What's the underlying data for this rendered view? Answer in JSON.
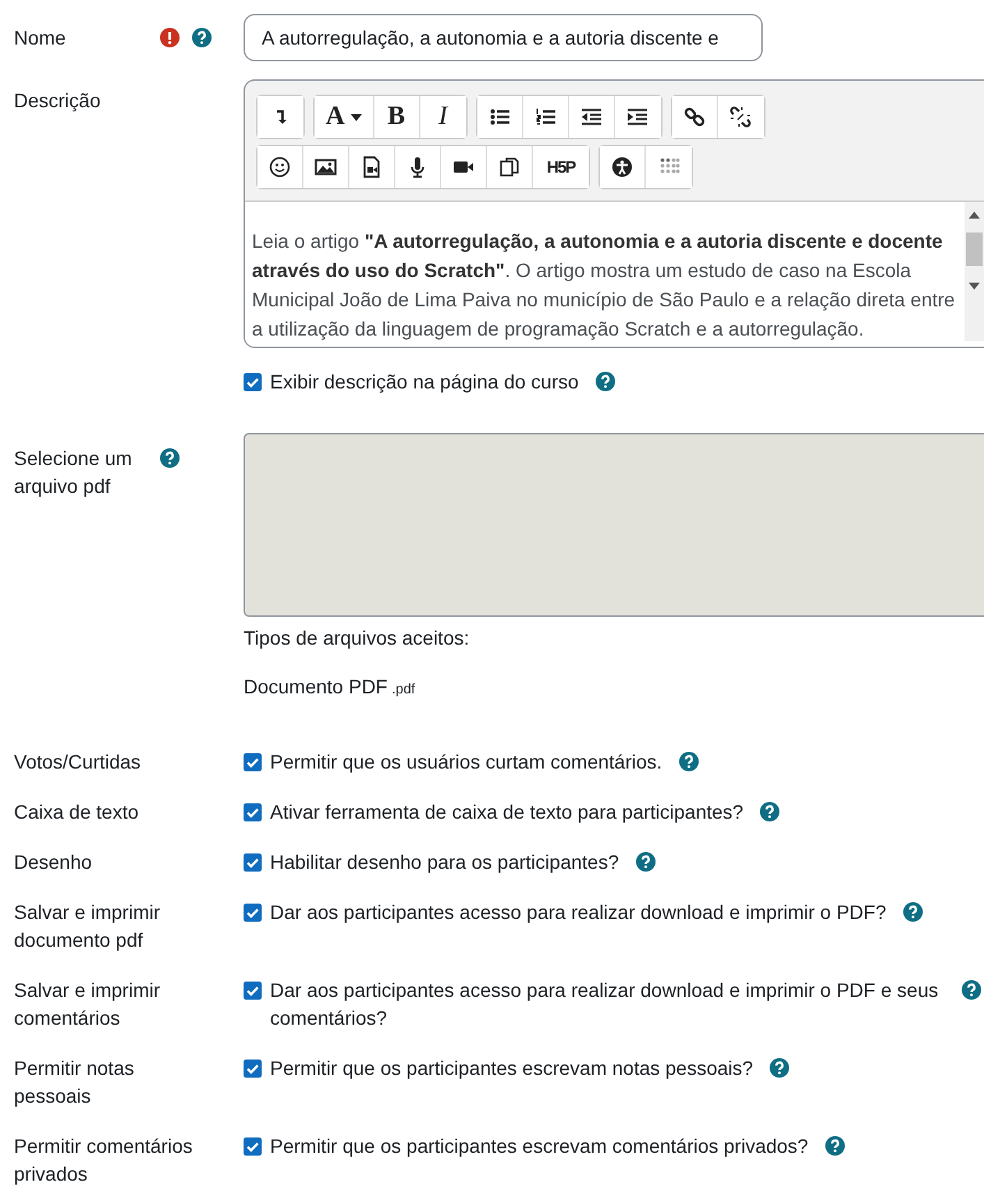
{
  "name_field": {
    "label": "Nome",
    "required": true,
    "help": true,
    "value": "A autorregulação, a autonomia e a autoria discente e"
  },
  "description": {
    "label": "Descrição",
    "toolbar": [
      [
        {
          "kind": "collapse"
        }
      ],
      [
        {
          "kind": "font",
          "label": "A"
        },
        {
          "kind": "bold",
          "label": "B"
        },
        {
          "kind": "italic",
          "label": "I"
        }
      ],
      [
        {
          "kind": "bullets"
        },
        {
          "kind": "numbers"
        },
        {
          "kind": "outdent"
        },
        {
          "kind": "indent"
        }
      ],
      [
        {
          "kind": "link"
        },
        {
          "kind": "unlink"
        }
      ],
      [
        {
          "kind": "emoji"
        },
        {
          "kind": "image"
        },
        {
          "kind": "media"
        },
        {
          "kind": "mic"
        },
        {
          "kind": "video"
        },
        {
          "kind": "copy"
        },
        {
          "kind": "h5p",
          "label": "H5P"
        }
      ],
      [
        {
          "kind": "accessibility"
        },
        {
          "kind": "braille"
        }
      ]
    ],
    "content": "Leia o artigo **\"A autorregulação, a autonomia e a autoria discente e docente através do uso do Scratch\"**. O artigo mostra um estudo de caso na Escola Municipal João de Lima Paiva no município de São Paulo e a relação direta entre a utilização da linguagem de programação Scratch e a autorregulação.",
    "show_on_page": {
      "label": "Exibir descrição na página do curso",
      "checked": true,
      "help": true
    }
  },
  "file": {
    "label": "Selecione um arquivo pdf",
    "help": true,
    "accepted_title": "Tipos de arquivos aceitos:",
    "type_name": "Documento PDF",
    "type_ext": ".pdf"
  },
  "options": [
    {
      "label": "Votos/Curtidas",
      "text": "Permitir que os usuários curtam comentários.",
      "checked": true,
      "help": true
    },
    {
      "label": "Caixa de texto",
      "text": "Ativar ferramenta de caixa de texto para participantes?",
      "checked": true,
      "help": true
    },
    {
      "label": "Desenho",
      "text": "Habilitar desenho para os participantes?",
      "checked": true,
      "help": true
    },
    {
      "label": "Salvar e imprimir documento pdf",
      "text": "Dar aos participantes acesso para realizar download e imprimir o PDF?",
      "checked": true,
      "help": true
    },
    {
      "label": "Salvar e imprimir comentários",
      "text": "Dar aos participantes acesso para realizar download e imprimir o PDF e seus comentários?",
      "checked": true,
      "help": true,
      "help_far": true
    },
    {
      "label": "Permitir notas pessoais",
      "text": "Permitir que os participantes escrevam notas pessoais?",
      "checked": true,
      "help": true
    },
    {
      "label": "Permitir comentários privados",
      "text": "Permitir que os participantes escrevam comentários privados?",
      "checked": true,
      "help": true
    }
  ]
}
